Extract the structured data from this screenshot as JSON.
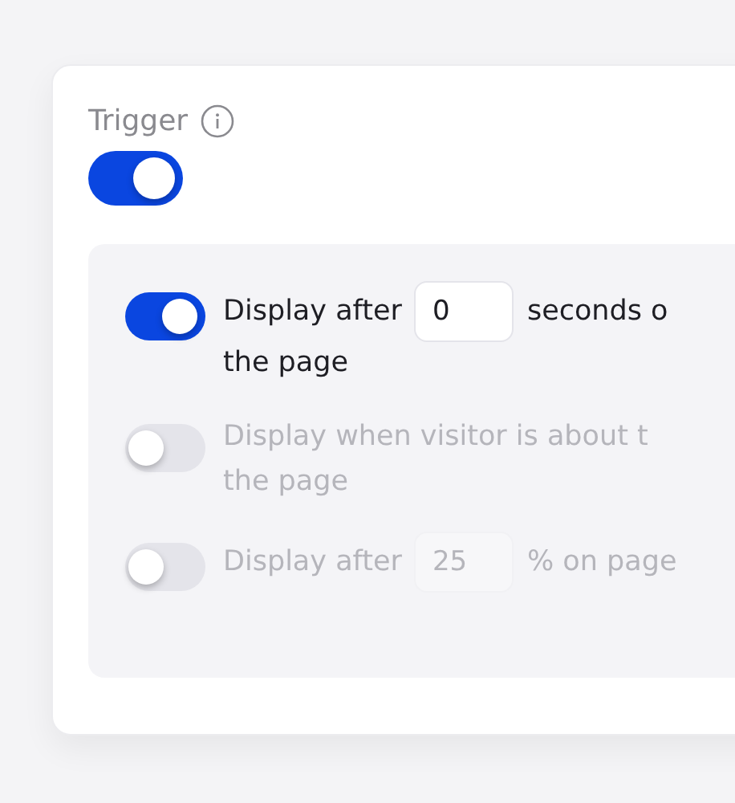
{
  "trigger": {
    "label": "Trigger",
    "on": true
  },
  "options": [
    {
      "on": true,
      "lines": [
        [
          {
            "kind": "text",
            "text": "Display after"
          },
          {
            "kind": "field",
            "value": "0"
          },
          {
            "kind": "text",
            "text": "seconds o"
          }
        ],
        [
          {
            "kind": "text",
            "text": "the page"
          }
        ]
      ]
    },
    {
      "on": false,
      "lines": [
        [
          {
            "kind": "text",
            "text": "Display when visitor is about t"
          }
        ],
        [
          {
            "kind": "text",
            "text": "the page"
          }
        ]
      ]
    },
    {
      "on": false,
      "lines": [
        [
          {
            "kind": "text",
            "text": "Display after"
          },
          {
            "kind": "field",
            "value": "25"
          },
          {
            "kind": "text",
            "text": "% on page"
          }
        ]
      ]
    }
  ]
}
